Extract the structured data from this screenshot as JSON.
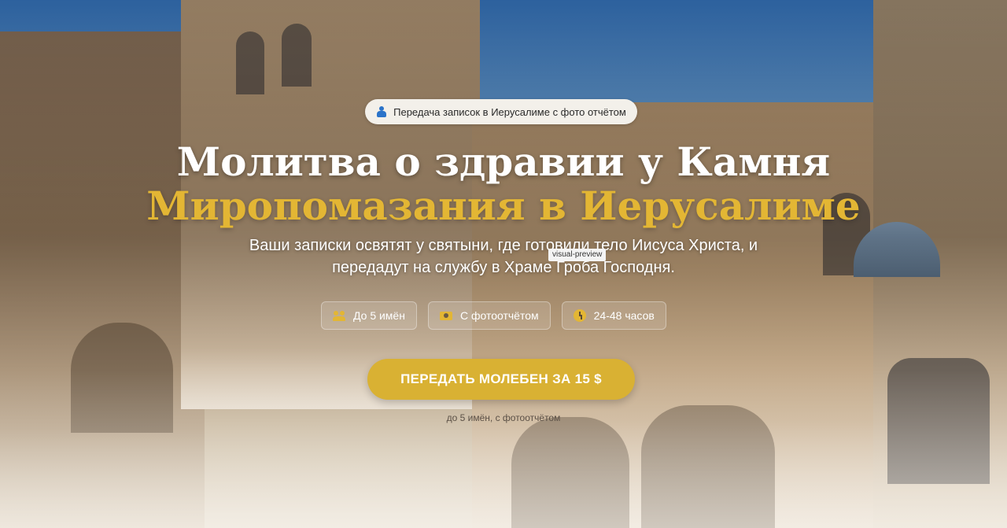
{
  "badge": {
    "icon": "praying-person-icon",
    "text": "Передача записок в Иерусалиме с фото отчётом"
  },
  "title": {
    "line1": "Молитва о здравии у Камня",
    "line2": "Миропомазания в Иерусалиме",
    "accent_color": "#e3b634"
  },
  "subtitle": "Ваши записки освятят у святыни, где готовили тело Иисуса Христа, и передадут на службу в Храме Гроба Господня.",
  "dev_tag": "visual-preview",
  "features": [
    {
      "icon": "people-icon",
      "label": "До 5 имён"
    },
    {
      "icon": "camera-icon",
      "label": "С фотоотчётом"
    },
    {
      "icon": "clock-icon",
      "label": "24-48 часов"
    }
  ],
  "cta": {
    "label": "ПЕРЕДАТЬ МОЛЕБЕН ЗА 15 $",
    "color": "#d9b133"
  },
  "cta_note": "до 5 имён, с фотоотчётом"
}
